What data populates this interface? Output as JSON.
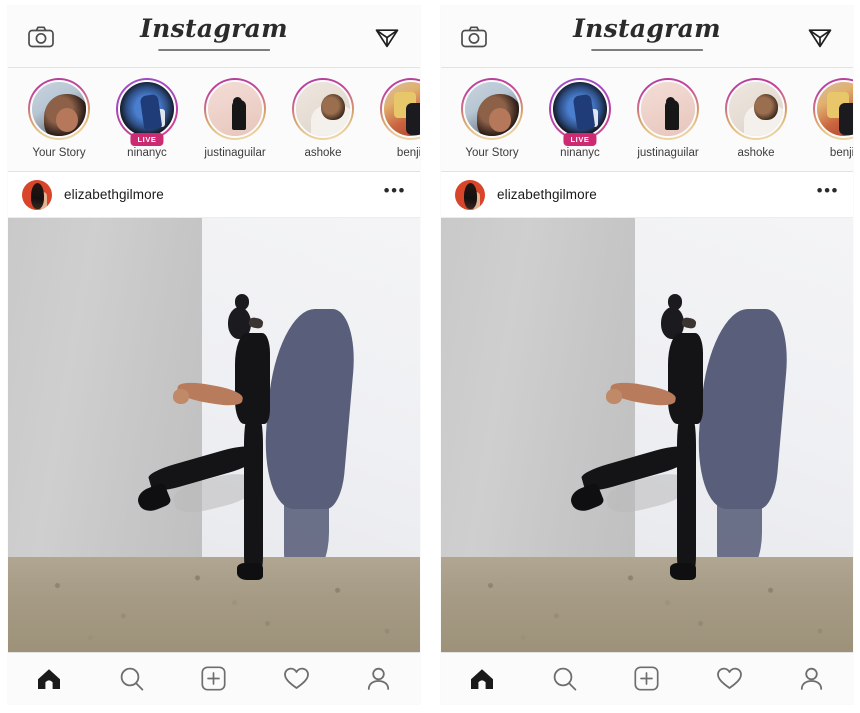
{
  "app": {
    "title": "Instagram",
    "wordmark": "Instagram"
  },
  "topbar": {
    "camera_icon": "camera-icon",
    "send_icon": "send-paper-plane-icon"
  },
  "stories": [
    {
      "name": "Your Story",
      "live": false,
      "avatar": "av-yourstory"
    },
    {
      "name": "ninanyc",
      "live": true,
      "live_label": "LIVE",
      "avatar": "av-nina"
    },
    {
      "name": "justinaguilar",
      "live": false,
      "avatar": "av-justin"
    },
    {
      "name": "ashoke",
      "live": false,
      "avatar": "av-ashoke"
    },
    {
      "name": "benjir",
      "live": false,
      "avatar": "av-benji"
    }
  ],
  "post": {
    "username": "elizabethgilmore",
    "more_label": "•••",
    "image_alt": "woman in black kicking in front of a two-tone white and grey wall with her shadow"
  },
  "bottom_nav": [
    {
      "name": "home",
      "icon": "home-icon",
      "active": true
    },
    {
      "name": "search",
      "icon": "search-icon",
      "active": false
    },
    {
      "name": "new-post",
      "icon": "plus-square-icon",
      "active": false
    },
    {
      "name": "activity",
      "icon": "heart-icon",
      "active": false
    },
    {
      "name": "profile",
      "icon": "person-icon",
      "active": false
    }
  ],
  "colors": {
    "page_background": "#ffffff",
    "panel_background": "#fafafa",
    "chrome_background": "#fbfbfb",
    "divider": "#e2e2e2",
    "text_primary": "#1a1a1a",
    "text_secondary": "#3c3c3c",
    "live_badge": "#cc2a72",
    "ring_gradient_start": "#b13fa0",
    "ring_gradient_end": "#f0ddb5",
    "avatar_accent": "#d9452a"
  },
  "panels": [
    {
      "id": "panel-left",
      "label": "Instagram feed screen (left copy)"
    },
    {
      "id": "panel-right",
      "label": "Instagram feed screen (right copy)"
    }
  ]
}
